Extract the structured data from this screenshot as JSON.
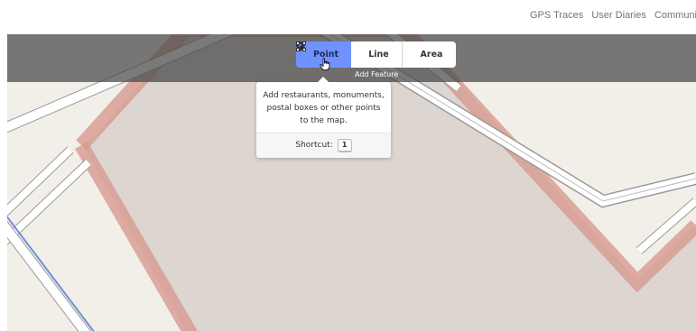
{
  "nav": {
    "links": [
      "GPS Traces",
      "User Diaries",
      "Communitie"
    ]
  },
  "modes": [
    {
      "label": "Point",
      "icon": "marker-icon",
      "active": true
    },
    {
      "label": "Line",
      "icon": "line-icon",
      "active": false
    },
    {
      "label": "Area",
      "icon": "area-icon",
      "active": false
    }
  ],
  "add_feature_label": "Add Feature",
  "tooltip": {
    "description": "Add restaurants, monuments, postal boxes or other points to the map.",
    "shortcut_label": "Shortcut:",
    "shortcut_key": "1"
  },
  "colors": {
    "active_mode": "#7092ff",
    "landuse_area": "#dcd5d0",
    "landuse_outline": "#d79a8f",
    "background": "#f2efe9",
    "waterway": "#6f8fd8"
  }
}
